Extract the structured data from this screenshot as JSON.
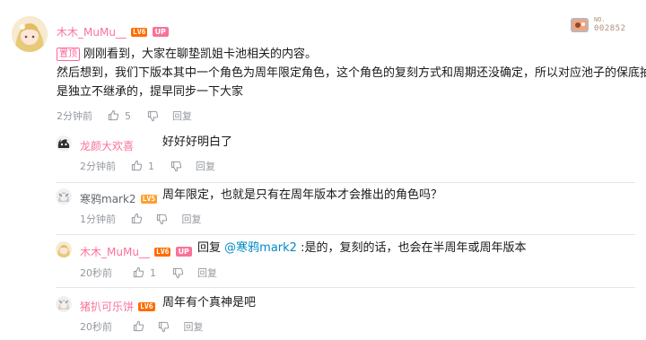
{
  "main_comment": {
    "username": "木木_MuMu__",
    "level": "LV6",
    "up_badge": "UP",
    "pin_label": "置顶",
    "line1": "刚刚看到，大家在聊垫凯姐卡池相关的内容。",
    "line2": "然后想到，我们下版本其中一个角色为周年限定角色，这个角色的复刻方式和周期还没确定，所以对应池子的保底抽数",
    "line3": "是独立不继承的，提早同步一下大家",
    "time": "2分钟前",
    "likes": "5",
    "reply_label": "回复",
    "fan_badge_number": "002852"
  },
  "replies": [
    {
      "username": "龙颜大欢喜",
      "level": "",
      "up_badge": "",
      "text": "好好好明白了",
      "time": "2分钟前",
      "likes": "1",
      "reply_label": "回复"
    },
    {
      "username": "寒鸦mark2",
      "level": "LV5",
      "up_badge": "",
      "text": "周年限定，也就是只有在周年版本才会推出的角色吗？",
      "time": "1分钟前",
      "likes": "",
      "reply_label": "回复"
    },
    {
      "username": "木木_MuMu__",
      "level": "LV6",
      "up_badge": "UP",
      "reply_prefix": "回复",
      "mention": "@寒鸦mark2",
      "text": ":是的，复刻的话，也会在半周年或周年版本",
      "time": "20秒前",
      "likes": "1",
      "reply_label": "回复"
    },
    {
      "username": "猪扒可乐饼",
      "level": "LV6",
      "up_badge": "",
      "text": "周年有个真神是吧",
      "time": "20秒前",
      "likes": "",
      "reply_label": "回复"
    }
  ],
  "colors": {
    "accent_pink": "#fb7299",
    "level6": "#ff6c00",
    "level5": "#ff9f2e",
    "mention_blue": "#008ac5"
  }
}
